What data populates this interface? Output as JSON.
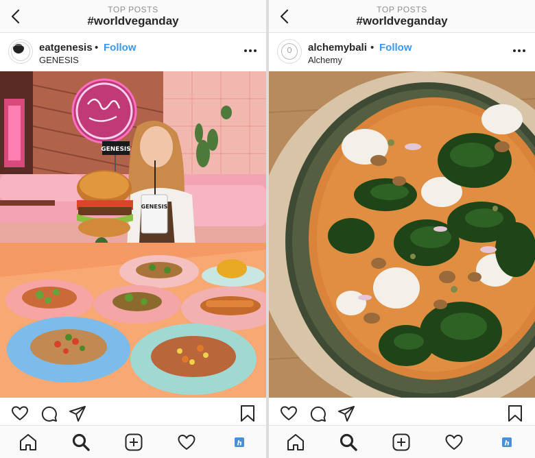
{
  "posts": [
    {
      "header": {
        "kicker": "TOP POSTS",
        "hashtag": "#worldveganday"
      },
      "author": {
        "username": "eatgenesis",
        "separator": "•",
        "follow_label": "Follow",
        "location": "GENESIS"
      },
      "photo": {
        "subject": "vegan burger and dishes at pink neon restaurant",
        "sign_text": "GENESIS",
        "cup_text": "GENESIS"
      }
    },
    {
      "header": {
        "kicker": "TOP POSTS",
        "hashtag": "#worldveganday"
      },
      "author": {
        "username": "alchemybali",
        "separator": "•",
        "follow_label": "Follow",
        "location": "Alchemy"
      },
      "photo": {
        "subject": "vegan pizza with greens and mushrooms"
      }
    }
  ],
  "icons": {
    "back": "chevron-left-icon",
    "more": "more-dots-icon",
    "like": "heart-icon",
    "comment": "comment-icon",
    "share": "paper-plane-icon",
    "save": "bookmark-icon",
    "home": "home-icon",
    "search": "search-icon",
    "new_post": "plus-square-icon",
    "activity": "heart-icon",
    "profile": "profile-icon"
  },
  "colors": {
    "accent": "#3897f0",
    "text": "#262626",
    "muted": "#8e8e8e",
    "profile_badge": "#4a90d9"
  }
}
